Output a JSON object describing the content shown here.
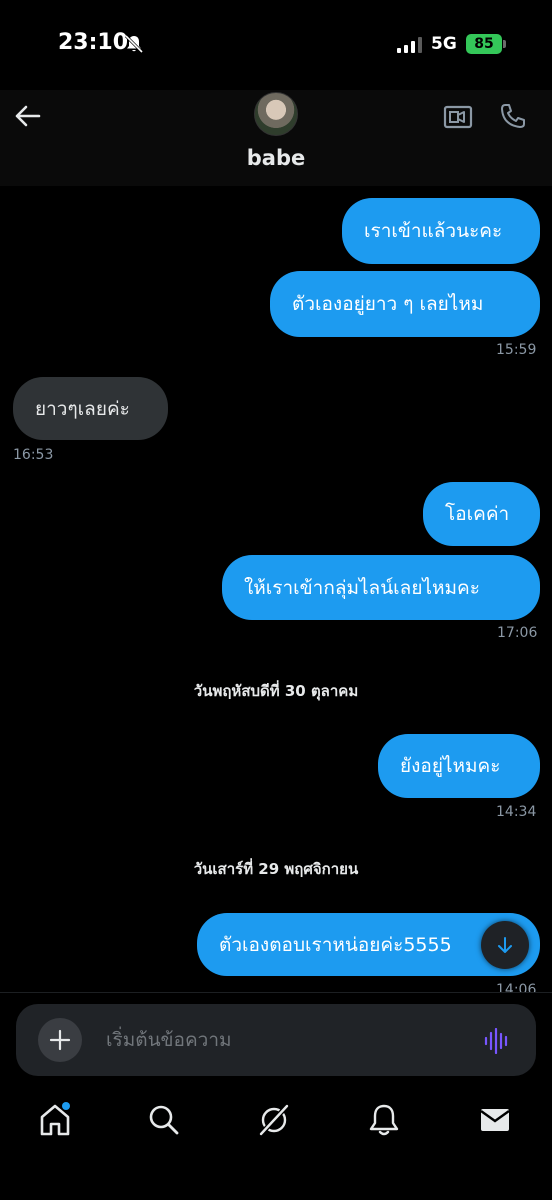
{
  "status_bar": {
    "time": "23:10",
    "network": "5G",
    "battery": "85"
  },
  "header": {
    "name": "babe"
  },
  "messages": [
    {
      "text": "เราเข้าแล้วนะคะ"
    },
    {
      "text": "ตัวเองอยู่ยาว ๆ เลยไหม",
      "time": "15:59"
    },
    {
      "text": "ยาวๆเลยค่ะ",
      "time": "16:53"
    },
    {
      "text": "โอเคค่า"
    },
    {
      "text": "ให้เราเข้ากลุ่มไลน์เลยไหมคะ",
      "time": "17:06"
    },
    {
      "text": "ยังอยู่ไหมคะ",
      "time": "14:34"
    },
    {
      "text": "ตัวเองตอบเราหน่อยค่ะ5555",
      "time": "14:06"
    }
  ],
  "date_separators": [
    "วันพฤหัสบดีที่ 30 ตุลาคม",
    "วันเสาร์ที่ 29 พฤศจิกายน"
  ],
  "composer": {
    "placeholder": "เริ่มต้นข้อความ"
  },
  "colors": {
    "accent": "#1d9bf0",
    "incoming_bubble": "#2f3336",
    "background": "#000000",
    "voice": "#7856ff"
  },
  "icons": {
    "header": [
      "back-arrow-icon",
      "video-call-icon",
      "phone-icon"
    ],
    "nav": [
      "home-icon",
      "search-icon",
      "grok-icon",
      "bell-icon",
      "mail-icon"
    ]
  }
}
